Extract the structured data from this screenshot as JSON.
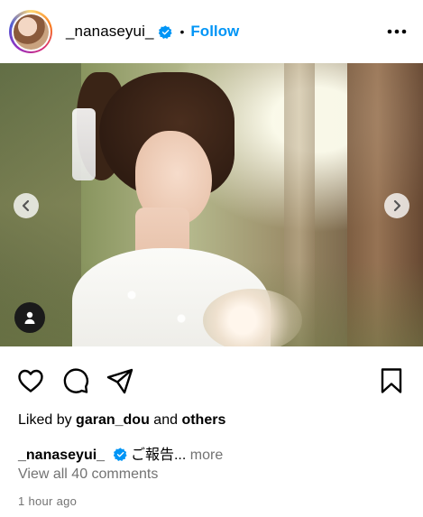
{
  "header": {
    "username": "_nanaseyui_",
    "separator": "•",
    "follow_label": "Follow",
    "verified": true
  },
  "media": {
    "carousel_prev": "previous",
    "carousel_next": "next",
    "user_tag": "tagged-user"
  },
  "actions": {
    "like_icon": "heart-icon",
    "comment_icon": "comment-icon",
    "share_icon": "share-icon",
    "save_icon": "bookmark-icon"
  },
  "likes": {
    "prefix": "Liked by ",
    "user": "garan_dou",
    "joiner": " and ",
    "others": "others"
  },
  "caption": {
    "username": "_nanaseyui_",
    "text": " ご報告...",
    "more_label": " more"
  },
  "comments": {
    "label": "View all 40 comments"
  },
  "timestamp": "1 hour ago",
  "colors": {
    "accent": "#0095f6",
    "muted": "#737373",
    "text": "#000000"
  }
}
